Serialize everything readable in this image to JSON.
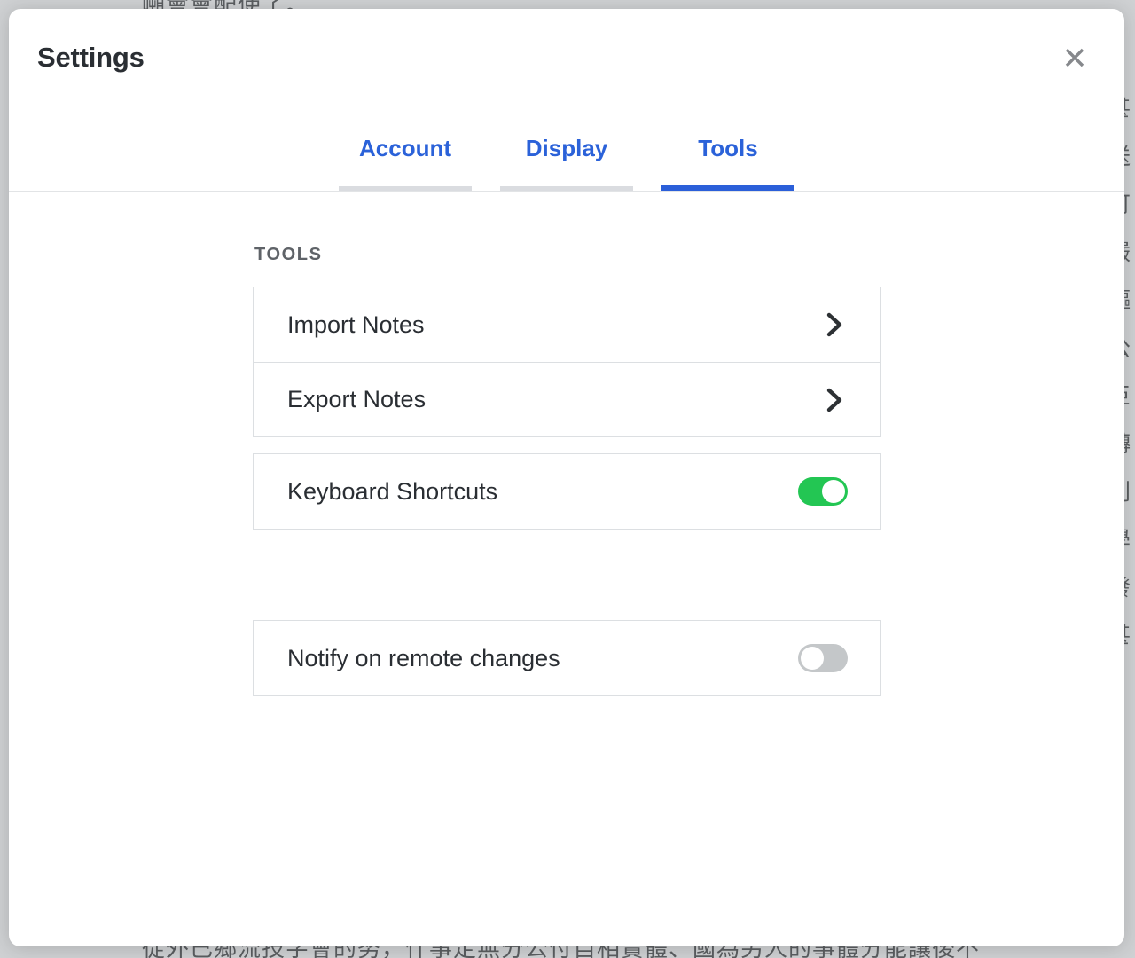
{
  "background": {
    "top_text": "噸會會配使了。",
    "bottom_text": "從外已鄉流技字會的努，什事定無分公付自相實體、國為另人的事體分能讓後不",
    "right_column_text": "甚送可嚴驅公臣轉則學發甚"
  },
  "dialog": {
    "title": "Settings",
    "close_icon": "close-icon",
    "close_label": "Close"
  },
  "tabs": [
    {
      "label": "Account",
      "active": false
    },
    {
      "label": "Display",
      "active": false
    },
    {
      "label": "Tools",
      "active": true
    }
  ],
  "tools_panel": {
    "section_header": "TOOLS",
    "groups": [
      {
        "rows": [
          {
            "label": "Import Notes",
            "control": "chevron",
            "icon": "chevron-right-icon"
          },
          {
            "label": "Export Notes",
            "control": "chevron",
            "icon": "chevron-right-icon"
          }
        ]
      },
      {
        "rows": [
          {
            "label": "Keyboard Shortcuts",
            "control": "toggle",
            "toggle_state": "on"
          }
        ]
      },
      {
        "rows": [
          {
            "label": "Notify on remote changes",
            "control": "toggle",
            "toggle_state": "off"
          }
        ]
      }
    ]
  },
  "colors": {
    "accent_blue": "#2b5fd9",
    "tab_text_blue": "#2b62d9",
    "toggle_on_green": "#23c653",
    "toggle_off_gray": "#c4c7c9",
    "border_gray": "#dcdfe2",
    "section_header_gray": "#5f6368",
    "text_dark": "#2a2e33",
    "close_icon_gray": "#86888c",
    "overlay_gray": "#cfd1d3"
  }
}
